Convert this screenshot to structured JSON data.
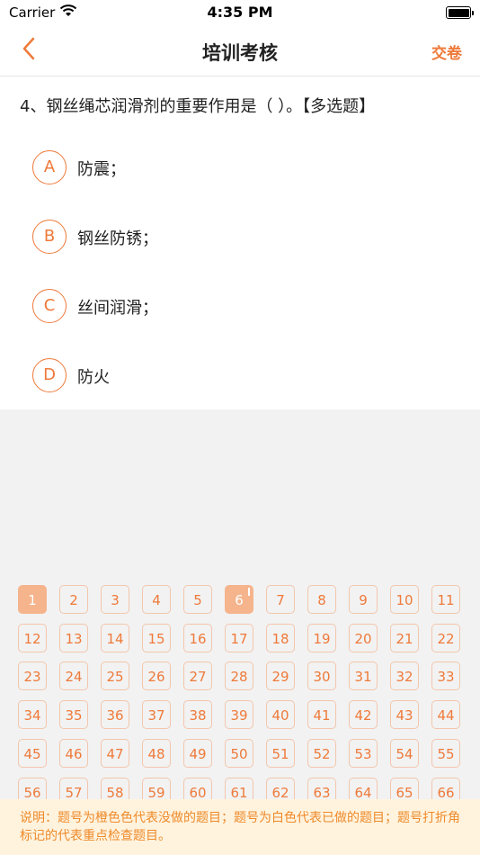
{
  "status": {
    "carrier": "Carrier",
    "time": "4:35 PM"
  },
  "nav": {
    "title": "培训考核",
    "submit": "交卷"
  },
  "question": {
    "text": "4、钢丝绳芯润滑剂的重要作用是（ ）。【多选题】",
    "options": [
      {
        "letter": "A",
        "text": "防震；"
      },
      {
        "letter": "B",
        "text": "钢丝防锈；"
      },
      {
        "letter": "C",
        "text": "丝间润滑；"
      },
      {
        "letter": "D",
        "text": "防火"
      }
    ]
  },
  "answer_sheet": {
    "numbers": [
      "1",
      "2",
      "3",
      "4",
      "5",
      "6",
      "7",
      "8",
      "9",
      "10",
      "11",
      "12",
      "13",
      "14",
      "15",
      "16",
      "17",
      "18",
      "19",
      "20",
      "21",
      "22",
      "23",
      "24",
      "25",
      "26",
      "27",
      "28",
      "29",
      "30",
      "31",
      "32",
      "33",
      "34",
      "35",
      "36",
      "37",
      "38",
      "39",
      "40",
      "41",
      "42",
      "43",
      "44",
      "45",
      "46",
      "47",
      "48",
      "49",
      "50",
      "51",
      "52",
      "53",
      "54",
      "55",
      "56",
      "57",
      "58",
      "59",
      "60",
      "61",
      "62",
      "63",
      "64",
      "65",
      "66"
    ],
    "active": [
      1,
      6
    ],
    "flagged": [
      6
    ]
  },
  "note": "说明：题号为橙色色代表没做的题目；题号为白色代表已做的题目；题号打折角标记的代表重点检查题目。",
  "colors": {
    "accent": "#ee7a3a",
    "active_fill": "#f5b48c",
    "note_bg": "#fff3de"
  }
}
